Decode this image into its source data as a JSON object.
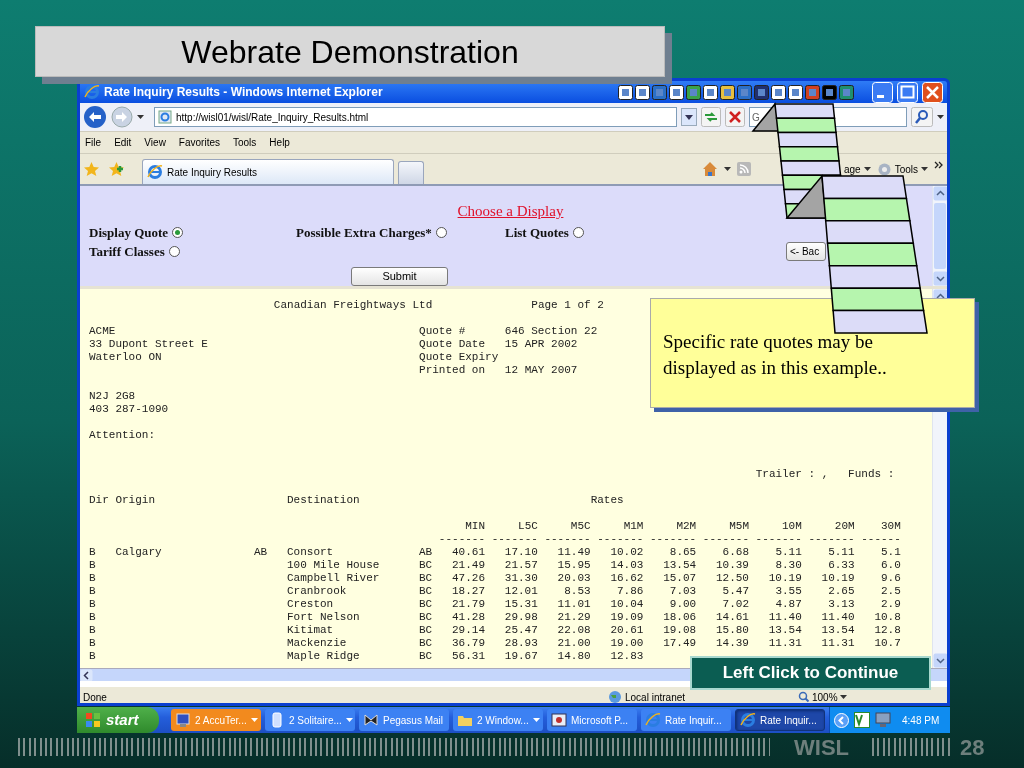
{
  "slide": {
    "title": "Webrate Demonstration",
    "footer_brand": "WISL",
    "page_number": "28"
  },
  "window": {
    "title": "Rate Inquiry Results - Windows Internet Explorer"
  },
  "address_bar": {
    "url": "http://wisl01/wisl/Rate_Inquiry_Results.html"
  },
  "search": {
    "placeholder": "G"
  },
  "menu": [
    "File",
    "Edit",
    "View",
    "Favorites",
    "Tools",
    "Help"
  ],
  "tabs": [
    {
      "label": "Rate Inquiry Results",
      "selected": true
    }
  ],
  "command_bar": [
    "age",
    "Tools"
  ],
  "form": {
    "heading": "Choose a Display",
    "options": [
      {
        "label": "Display Quote",
        "selected": true
      },
      {
        "label": "Possible Extra Charges*",
        "selected": false
      },
      {
        "label": "List Quotes",
        "selected": false
      },
      {
        "label": "Tariff Classes",
        "selected": false
      }
    ],
    "submit": "Submit",
    "back": "<- Bac"
  },
  "report": {
    "company": "Canadian Freightways Ltd",
    "page": "Page 1 of 2",
    "address": [
      "ACME",
      "33 Dupont Street E",
      "Waterloo ON"
    ],
    "quote_fields": [
      {
        "label": "Quote #",
        "value": "646 Section 22"
      },
      {
        "label": "Quote Date",
        "value": "15 APR 2002"
      },
      {
        "label": "Quote Expiry"
      },
      {
        "label": "Printed on",
        "value": "12 MAY 2007"
      }
    ],
    "postal": [
      "N2J 2G8",
      "403 287-1090"
    ],
    "attention": "Attention:",
    "trailer": "Trailer : ,   Funds :",
    "headings": [
      "Dir",
      "Origin",
      "Destination",
      "Rates"
    ],
    "rate_columns": [
      "MIN",
      "L5C",
      "M5C",
      "M1M",
      "M2M",
      "M5M",
      "10M",
      "20M",
      "30M"
    ],
    "dashes": [
      "-------",
      "-------",
      "-------",
      "-------",
      "-------",
      "-------",
      "-------",
      "-------",
      "------"
    ],
    "rows": [
      {
        "dir": "B",
        "origin": "Calgary",
        "origin_prov": "AB",
        "destination": "Consort",
        "dest_prov": "AB",
        "rates": [
          "40.61",
          "17.10",
          "11.49",
          "10.02",
          "8.65",
          "6.68",
          "5.11",
          "5.11",
          "5.1"
        ]
      },
      {
        "dir": "B",
        "destination": "100 Mile House",
        "dest_prov": "BC",
        "rates": [
          "21.49",
          "21.57",
          "15.95",
          "14.03",
          "13.54",
          "10.39",
          "8.30",
          "6.33",
          "6.0"
        ]
      },
      {
        "dir": "B",
        "destination": "Campbell River",
        "dest_prov": "BC",
        "rates": [
          "47.26",
          "31.30",
          "20.03",
          "16.62",
          "15.07",
          "12.50",
          "10.19",
          "10.19",
          "9.6"
        ]
      },
      {
        "dir": "B",
        "destination": "Cranbrook",
        "dest_prov": "BC",
        "rates": [
          "18.27",
          "12.01",
          "8.53",
          "7.86",
          "7.03",
          "5.47",
          "3.55",
          "2.65",
          "2.5"
        ]
      },
      {
        "dir": "B",
        "destination": "Creston",
        "dest_prov": "BC",
        "rates": [
          "21.79",
          "15.31",
          "11.01",
          "10.04",
          "9.00",
          "7.02",
          "4.87",
          "3.13",
          "2.9"
        ]
      },
      {
        "dir": "B",
        "destination": "Fort Nelson",
        "dest_prov": "BC",
        "rates": [
          "41.28",
          "29.98",
          "21.29",
          "19.09",
          "18.06",
          "14.61",
          "11.40",
          "11.40",
          "10.8"
        ]
      },
      {
        "dir": "B",
        "destination": "Kitimat",
        "dest_prov": "BC",
        "rates": [
          "29.14",
          "25.47",
          "22.08",
          "20.61",
          "19.08",
          "15.80",
          "13.54",
          "13.54",
          "12.8"
        ]
      },
      {
        "dir": "B",
        "destination": "Mackenzie",
        "dest_prov": "BC",
        "rates": [
          "36.79",
          "28.93",
          "21.00",
          "19.00",
          "17.49",
          "14.39",
          "11.31",
          "11.31",
          "10.7"
        ]
      },
      {
        "dir": "B",
        "destination": "Maple Ridge",
        "dest_prov": "BC",
        "rates": [
          "56.31",
          "19.67",
          "14.80",
          "12.83"
        ]
      }
    ]
  },
  "status_bar": {
    "text": "Done",
    "zone": "Local intranet",
    "zoom": "100%"
  },
  "taskbar": {
    "start": "start",
    "items": [
      {
        "label": "2 AccuTer...",
        "grouped": true,
        "flashing": true,
        "selected": false
      },
      {
        "label": "2 Solitaire...",
        "grouped": true,
        "flashing": false,
        "selected": false
      },
      {
        "label": "Pegasus Mail",
        "grouped": false,
        "flashing": false,
        "selected": false
      },
      {
        "label": "2 Window...",
        "grouped": true,
        "flashing": false,
        "selected": false
      },
      {
        "label": "Microsoft P...",
        "grouped": false,
        "flashing": false,
        "selected": false
      },
      {
        "label": "Rate Inquir...",
        "grouped": false,
        "flashing": false,
        "selected": false
      },
      {
        "label": "Rate Inquir...",
        "grouped": false,
        "flashing": false,
        "selected": true
      }
    ],
    "clock": "4:48 PM"
  },
  "callout": "Specific rate quotes may be displayed as in this example..",
  "continue_button": "Left Click to Continue"
}
